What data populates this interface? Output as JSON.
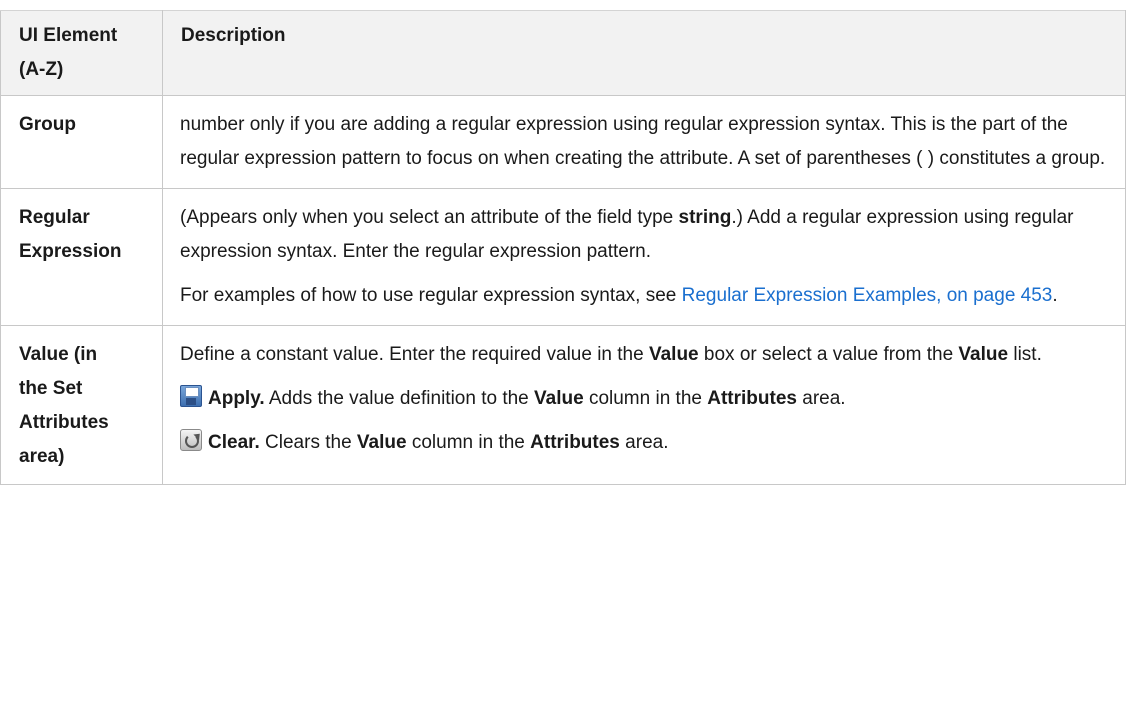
{
  "table": {
    "header": {
      "col1_line1": "UI Element",
      "col1_line2": "(A-Z)",
      "col2": "Description"
    },
    "rows": [
      {
        "element": "Group",
        "description": "number only if you are adding a regular expression using regular expression syntax. This is the part of the regular expression pattern to focus on when creating the attribute. A set of parentheses ( ) constitutes a group."
      },
      {
        "element_line1": "Regular",
        "element_line2": "Expression",
        "p1_pre": "(Appears only when you select an attribute of the field type ",
        "p1_bold": "string",
        "p1_post": ".) Add a regular expression using regular expression syntax. Enter the regular expression pattern.",
        "p2_pre": "For examples of how to use regular expression syntax, see ",
        "p2_link": "Regular Expression Examples, on page 453",
        "p2_post": "."
      },
      {
        "element_line1": "Value (in",
        "element_line2": "the Set",
        "element_line3": "Attributes",
        "element_line4": "area)",
        "p1_a": "Define a constant value. Enter the required value in the ",
        "p1_b": "Value",
        "p1_c": " box or select a value from the ",
        "p1_d": "Value",
        "p1_e": " list.",
        "apply_label": "Apply.",
        "apply_a": " Adds the value definition to the ",
        "apply_b": "Value",
        "apply_c": " column in the ",
        "apply_d": "Attributes",
        "apply_e": " area.",
        "clear_label": "Clear.",
        "clear_a": " Clears the ",
        "clear_b": "Value",
        "clear_c": " column in the ",
        "clear_d": "Attributes",
        "clear_e": " area.",
        "apply_icon": "save-icon",
        "clear_icon": "clear-icon"
      }
    ]
  },
  "colors": {
    "header_bg": "#f2f2f2",
    "border": "#c8c8c8",
    "link": "#1a6fcf",
    "text": "#1a1a1a"
  }
}
